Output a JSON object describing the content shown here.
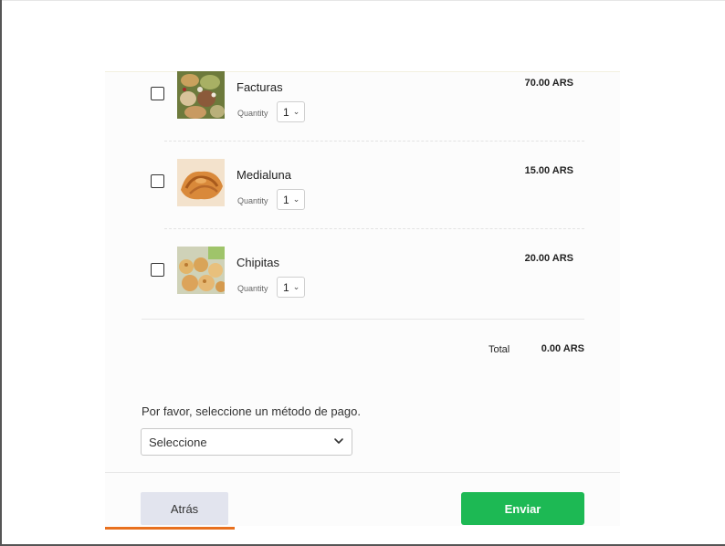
{
  "products": [
    {
      "name": "Facturas",
      "quantity_label": "Quantity",
      "quantity": "1",
      "price": "70.00 ARS",
      "image": "facturas-pastry-photo"
    },
    {
      "name": "Medialuna",
      "quantity_label": "Quantity",
      "quantity": "1",
      "price": "15.00 ARS",
      "image": "medialuna-croissant-photo"
    },
    {
      "name": "Chipitas",
      "quantity_label": "Quantity",
      "quantity": "1",
      "price": "20.00 ARS",
      "image": "chipitas-cheese-bread-photo"
    }
  ],
  "summary": {
    "total_label": "Total",
    "total_value": "0.00 ARS"
  },
  "payment": {
    "prompt": "Por favor, seleccione un método de pago.",
    "selected": "Seleccione"
  },
  "actions": {
    "back_label": "Atrás",
    "send_label": "Enviar"
  },
  "colors": {
    "send_button": "#1db954",
    "back_button": "#e2e4ee",
    "active_underline": "#e8701e"
  }
}
